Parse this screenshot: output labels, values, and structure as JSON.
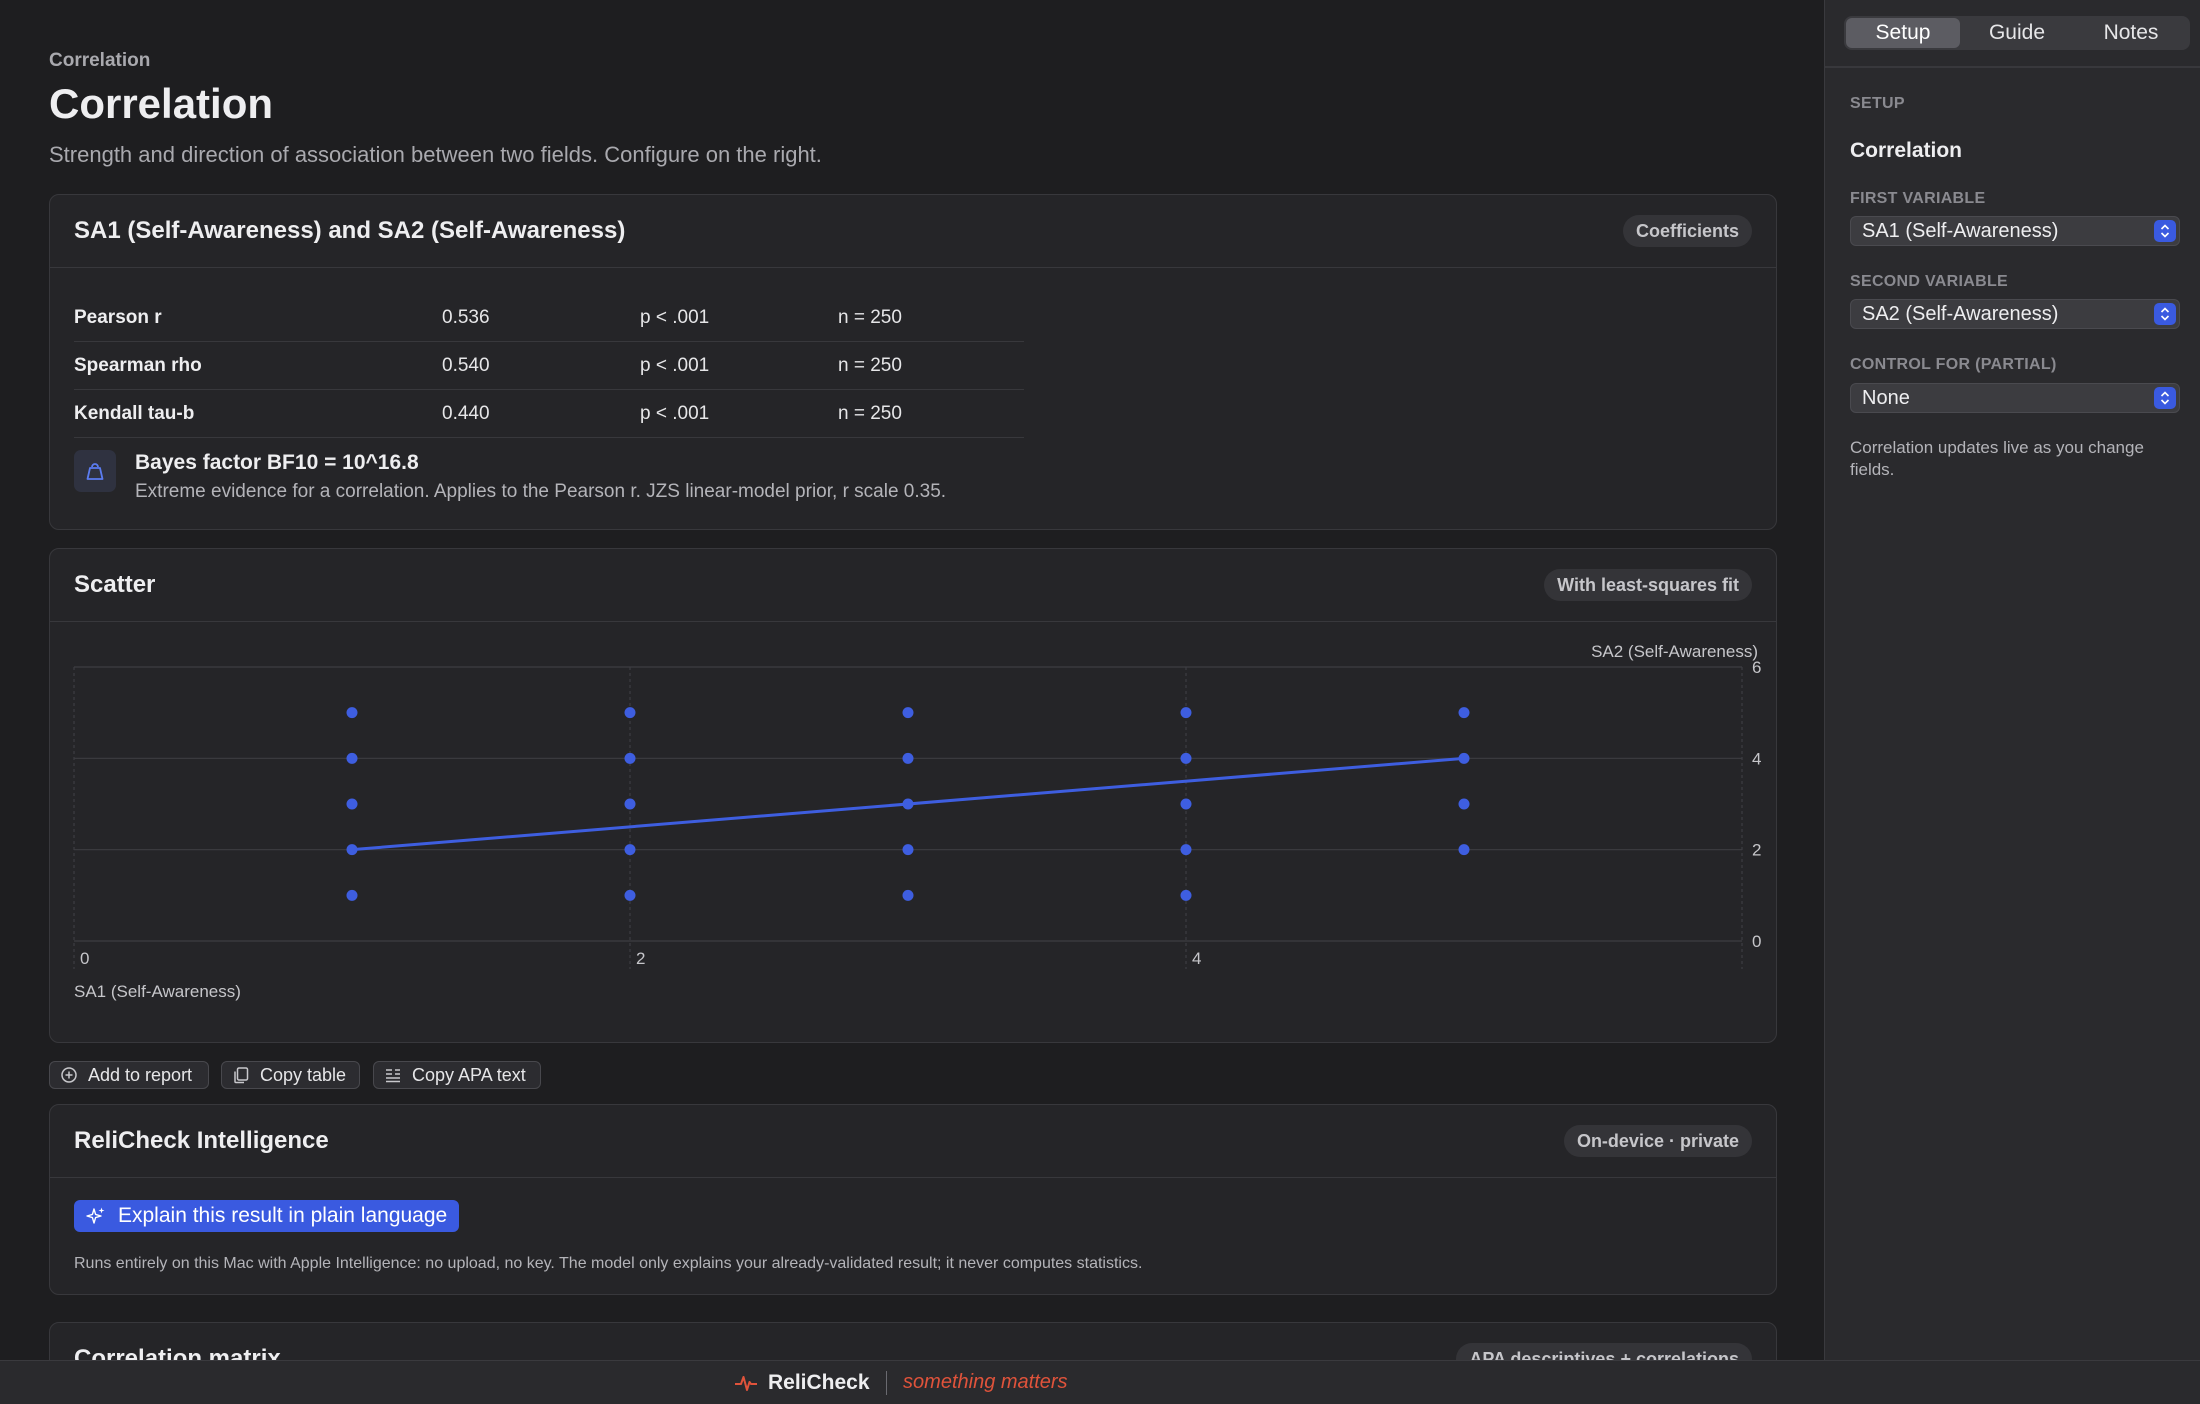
{
  "header": {
    "breadcrumb": "Correlation",
    "title": "Correlation",
    "subtitle": "Strength and direction of association between two fields. Configure on the right."
  },
  "coefficients_card": {
    "title": "SA1 (Self-Awareness) and SA2 (Self-Awareness)",
    "badge": "Coefficients",
    "rows": [
      {
        "name": "Pearson r",
        "value": "0.536",
        "p": "p < .001",
        "n": "n = 250"
      },
      {
        "name": "Spearman rho",
        "value": "0.540",
        "p": "p < .001",
        "n": "n = 250"
      },
      {
        "name": "Kendall tau-b",
        "value": "0.440",
        "p": "p < .001",
        "n": "n = 250"
      }
    ],
    "bayes": {
      "title": "Bayes factor BF10 = 10^16.8",
      "description": "Extreme evidence for a correlation. Applies to the Pearson r. JZS linear-model prior, r scale 0.35.",
      "icon": "weight-icon"
    }
  },
  "scatter_card": {
    "title": "Scatter",
    "badge": "With least-squares fit"
  },
  "chart_data": {
    "type": "scatter",
    "xlabel": "SA1 (Self-Awareness)",
    "ylabel": "SA2 (Self-Awareness)",
    "xlim": [
      0,
      6
    ],
    "ylim": [
      0,
      6
    ],
    "xticks": [
      "0",
      "2",
      "4"
    ],
    "yticks": [
      "0",
      "2",
      "4",
      "6"
    ],
    "grid": true,
    "points": [
      [
        1,
        1
      ],
      [
        1,
        2
      ],
      [
        1,
        3
      ],
      [
        1,
        4
      ],
      [
        1,
        5
      ],
      [
        2,
        1
      ],
      [
        2,
        2
      ],
      [
        2,
        3
      ],
      [
        2,
        4
      ],
      [
        2,
        5
      ],
      [
        3,
        1
      ],
      [
        3,
        2
      ],
      [
        3,
        3
      ],
      [
        3,
        4
      ],
      [
        3,
        5
      ],
      [
        4,
        1
      ],
      [
        4,
        2
      ],
      [
        4,
        3
      ],
      [
        4,
        4
      ],
      [
        4,
        5
      ],
      [
        5,
        2
      ],
      [
        5,
        3
      ],
      [
        5,
        4
      ],
      [
        5,
        5
      ]
    ],
    "fit_line": {
      "x": [
        1,
        5
      ],
      "y": [
        2,
        4
      ]
    },
    "color": "#3e5ee0"
  },
  "actions": [
    {
      "label": "Add to report",
      "icon": "plus-circle-icon"
    },
    {
      "label": "Copy table",
      "icon": "copy-icon"
    },
    {
      "label": "Copy APA text",
      "icon": "text-lines-icon"
    }
  ],
  "intelligence_card": {
    "title": "ReliCheck Intelligence",
    "badge": "On-device · private",
    "button": "Explain this result in plain language",
    "note": "Runs entirely on this Mac with Apple Intelligence: no upload, no key. The model only explains your already-validated result; it never computes statistics."
  },
  "matrix_card": {
    "title": "Correlation matrix",
    "badge": "APA descriptives + correlations"
  },
  "statusbar": {
    "brand": "ReliCheck",
    "tagline": "something matters",
    "accent": "#e0533b"
  },
  "sidebar": {
    "tabs": [
      "Setup",
      "Guide",
      "Notes"
    ],
    "active_tab": "Setup",
    "section": "SETUP",
    "title": "Correlation",
    "first_label": "FIRST VARIABLE",
    "first_value": "SA1 (Self-Awareness)",
    "second_label": "SECOND VARIABLE",
    "second_value": "SA2 (Self-Awareness)",
    "control_label": "CONTROL FOR (PARTIAL)",
    "control_value": "None",
    "note": "Correlation updates live as you change fields."
  }
}
